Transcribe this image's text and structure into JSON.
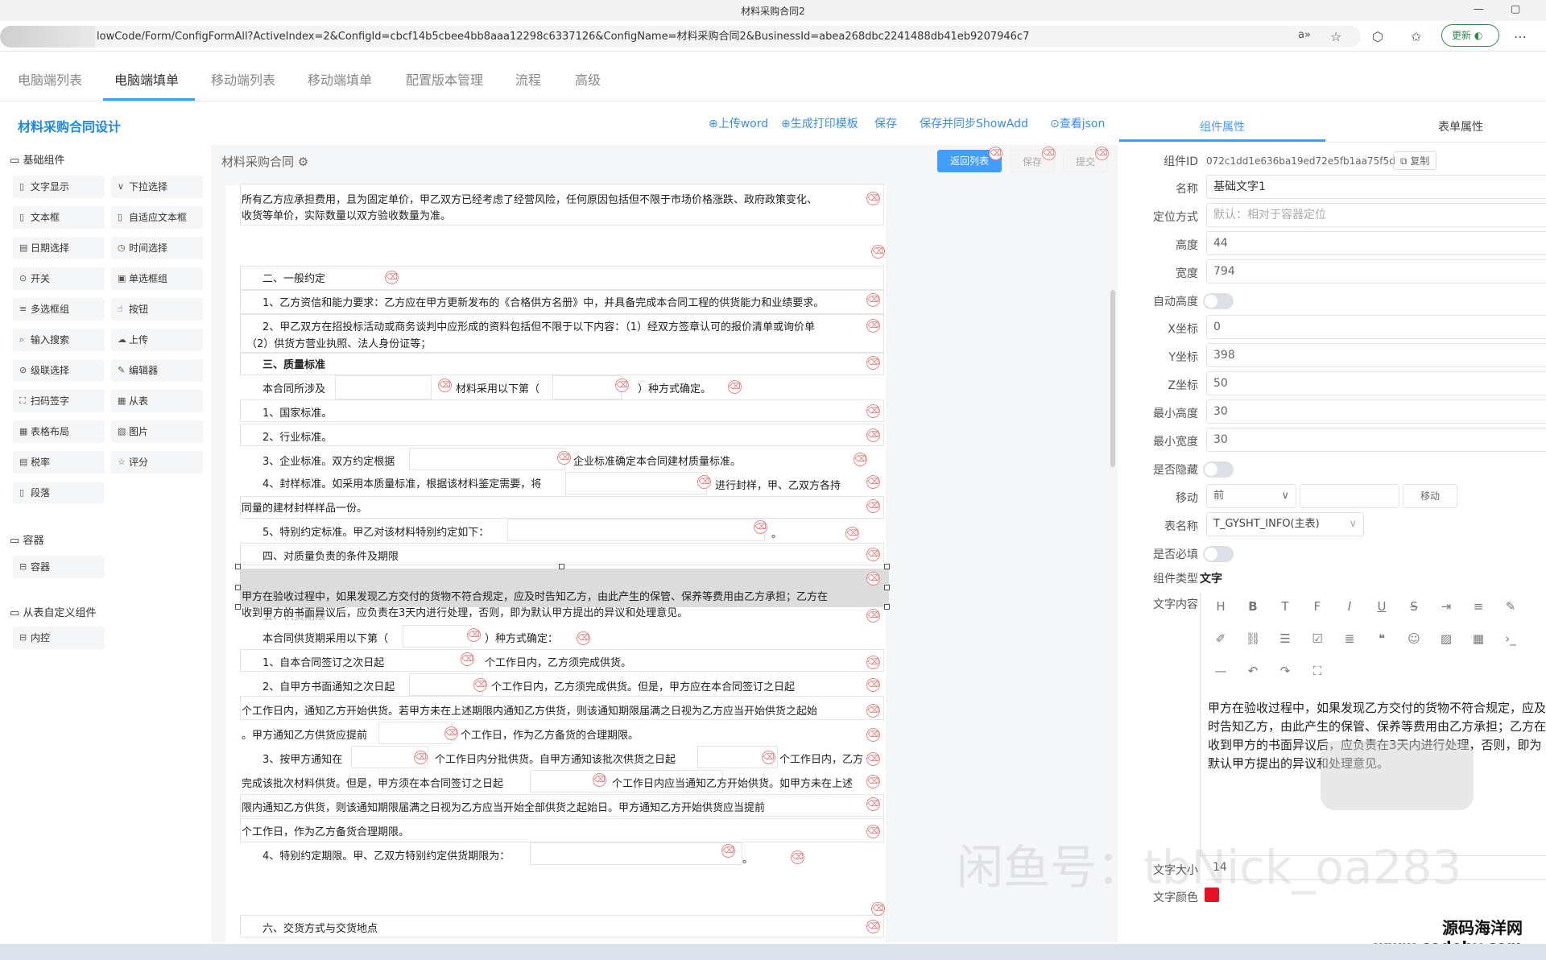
{
  "browser": {
    "window_title": "材料采购合同2",
    "url": "lowCode/Form/ConfigFormAll?ActiveIndex=2&ConfigId=cbcf14b5cbee4bb8aaa12298c6337126&ConfigName=材料采购合同2&BusinessId=abea268dbc2241488db41eb9207946c7",
    "update_label": "更新"
  },
  "tabs": [
    "电脑端列表",
    "电脑端填单",
    "移动端列表",
    "移动端填单",
    "配置版本管理",
    "流程",
    "高级"
  ],
  "header": {
    "title": "材料采购合同设计",
    "actions": [
      "⊕上传word",
      "⊕生成打印模板",
      "保存",
      "保存并同步ShowAdd",
      "⊙查看json"
    ]
  },
  "right_tabs": [
    "组件属性",
    "表单属性"
  ],
  "palette": {
    "basic_title": "基础组件",
    "basic": [
      "文字显示",
      "下拉选择",
      "文本框",
      "自适应文本框",
      "日期选择",
      "时间选择",
      "开关",
      "单选框组",
      "多选框组",
      "按钮",
      "输入搜索",
      "上传",
      "级联选择",
      "编辑器",
      "扫码签字",
      "从表",
      "表格布局",
      "图片",
      "税率",
      "评分",
      "段落"
    ],
    "container_title": "容器",
    "container": [
      "容器"
    ],
    "custom_title": "从表自定义组件",
    "custom": [
      "内控"
    ]
  },
  "form": {
    "title": "材料采购合同",
    "btn_back": "返回列表",
    "btn_save": "保存",
    "btn_submit": "提交",
    "lines": [
      "所有乙方应承担费用，且为固定单价，甲乙双方已经考虑了经营风险，任何原因包括但不限于市场价格涨跌、政府政策变化、",
      "收货等单价，实际数量以双方验收数量为准。",
      "二、一般约定",
      "1、乙方资信和能力要求：乙方应在甲方更新发布的《合格供方名册》中，并具备完成本合同工程的供货能力和业绩要求。",
      "2、甲乙双方在招投标活动或商务谈判中应形成的资料包括但不限于以下内容：（1）经双方签章认可的报价清单或询价单",
      "（2）供货方营业执照、法人身份证等；",
      "三、质量标准",
      "本合同所涉及",
      "材料采用以下第（",
      "）种方式确定。",
      "1、国家标准。",
      "2、行业标准。",
      "3、企业标准。双方约定根据",
      "企业标准确定本合同建材质量标准。",
      "4、封样标准。如采用本质量标准，根据该材料鉴定需要，将",
      "进行封样，甲、乙双方各持",
      "同量的建材封样样品一份。",
      "5、特别约定标准。甲乙对该材料特别约定如下：",
      "。",
      "四、对质量负责的条件及期限",
      "甲方在验收过程中，如果发现乙方交付的货物不符合规定，应及时告知乙方，由此产生的保管、保养等费用由乙方承担；乙方在",
      "收到甲方的书面异议后，应负责在3天内进行处理，否则，即为默认甲方提出的异议和处理意见。",
      "五、供货期限",
      "本合同供货期采用以下第（",
      "）种方式确定：",
      "1、自本合同签订之次日起",
      "个工作日内，乙方须完成供货。",
      "2、自甲方书面通知之次日起",
      "个工作日内，乙方须完成供货。但是，甲方应在本合同签订之日起",
      "个工作日内，通知乙方开始供货。若甲方未在上述期限内通知乙方供货，则该通知期限届满之日视为乙方应当开始供货之起始",
      "。甲方通知乙方供货应提前",
      "个工作日，作为乙方备货的合理期限。",
      "3、按甲方通知在",
      "个工作日内分批供货。自甲方通知该批次供货之日起",
      "个工作日内，乙方",
      "完成该批次材料供货。但是，甲方须在本合同签订之日起",
      "个工作日内应当通知乙方开始供货。如甲方未在上述",
      "限内通知乙方供货，则该通知期限届满之日视为乙方应当开始全部供货之起始日。甲方通知乙方开始供货应当提前",
      "个工作日，作为乙方备货合理期限。",
      "4、特别约定期限。甲、乙双方特别约定供货期限为：",
      "。",
      "六、交货方式与交货地点"
    ]
  },
  "props": {
    "id_label": "组件ID",
    "id_value": "072c1dd1e636ba19ed72e5fb1aa75f5d",
    "copy": "复制",
    "name_label": "名称",
    "name_value": "基础文字1",
    "pos_label": "定位方式",
    "pos_value": "默认：相对于容器定位",
    "h_label": "高度",
    "h_value": "44",
    "w_label": "宽度",
    "w_value": "794",
    "autoh_label": "自动高度",
    "x_label": "X坐标",
    "x_value": "0",
    "y_label": "Y坐标",
    "y_value": "398",
    "z_label": "Z坐标",
    "z_value": "50",
    "minh_label": "最小高度",
    "minh_value": "30",
    "minw_label": "最小宽度",
    "minw_value": "30",
    "hidden_label": "是否隐藏",
    "move_label": "移动",
    "move_value": "前",
    "move_btn": "移动",
    "table_label": "表名称",
    "table_value": "T_GYSHT_INFO(主表)",
    "required_label": "是否必填",
    "type_label": "组件类型",
    "type_value": "文字",
    "content_label": "文字内容",
    "content_value": "甲方在验收过程中，如果发现乙方交付的货物不符合规定，应及时告知乙方，由此产生的保管、保养等费用由乙方承担；乙方在收到甲方的书面异议后，应负责在3天内进行处理，否则，即为默认甲方提出的异议和处理意见。",
    "fontsize_label": "文字大小",
    "fontsize_value": "14",
    "color_label": "文字颜色",
    "color_value": "#e81123"
  },
  "overlay": {
    "watermark": "闲鱼号：tbNick_oa283",
    "corner_line1": "源码海洋网",
    "corner_line2": "www.codehy.com"
  }
}
